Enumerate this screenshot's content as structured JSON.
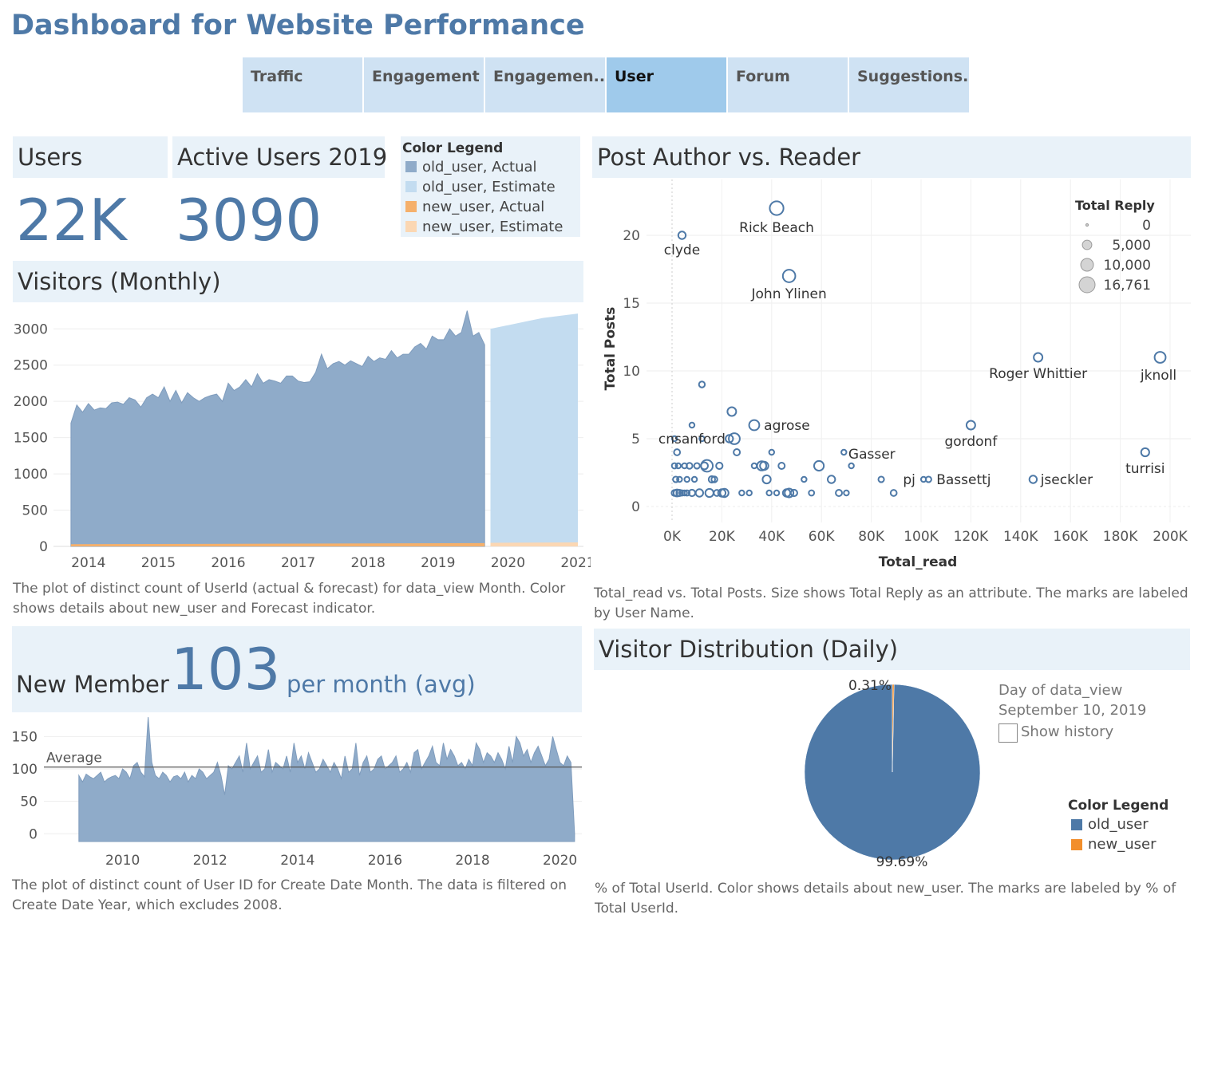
{
  "page": {
    "title": "Dashboard for Website Performance"
  },
  "tabs": [
    {
      "label": "Traffic",
      "active": false
    },
    {
      "label": "Engagement",
      "active": false
    },
    {
      "label": "Engagemen..",
      "active": false
    },
    {
      "label": "User",
      "active": true
    },
    {
      "label": "Forum",
      "active": false
    },
    {
      "label": "Suggestions..",
      "active": false
    }
  ],
  "kpis": {
    "users": {
      "label": "Users",
      "value": "22K"
    },
    "active": {
      "label": "Active Users 2019",
      "value": "3090"
    }
  },
  "color_legend_top": {
    "title": "Color Legend",
    "items": [
      {
        "label": "old_user, Actual",
        "color": "#8fabc9"
      },
      {
        "label": "old_user, Estimate",
        "color": "#c3dcf0"
      },
      {
        "label": "new_user, Actual",
        "color": "#f5b06b"
      },
      {
        "label": "new_user, Estimate",
        "color": "#fbd7b3"
      }
    ]
  },
  "visitors": {
    "header": "Visitors (Monthly)",
    "caption": "The plot of distinct count of UserId (actual & forecast)  for data_view Month.  Color shows details about new_user and Forecast indicator."
  },
  "new_member": {
    "prefix": "New Member",
    "value": "103",
    "suffix": "per month (avg)",
    "caption": "The plot of distinct count of User ID for Create Date Month. The data is filtered on Create Date Year, which excludes 2008."
  },
  "scatter": {
    "header": "Post Author vs. Reader",
    "caption": "Total_read vs. Total Posts.  Size shows Total Reply as an attribute.  The marks are labeled by User Name."
  },
  "pie": {
    "header": "Visitor Distribution (Daily)",
    "filter_label": "Day of data_view",
    "filter_value": "September 10, 2019",
    "show_history": "Show history",
    "legend_title": "Color Legend",
    "legend": [
      {
        "label": "old_user",
        "color": "#4e79a7"
      },
      {
        "label": "new_user",
        "color": "#f28e2b"
      }
    ],
    "caption": "% of Total UserId.  Color shows details about new_user.  The marks are labeled by % of Total UserId."
  },
  "chart_data": [
    {
      "type": "area",
      "x_ticks": [
        "2014",
        "2015",
        "2016",
        "2017",
        "2018",
        "2019",
        "2020",
        "2021"
      ],
      "y_ticks": [
        0,
        500,
        1000,
        1500,
        2000,
        2500,
        3000
      ],
      "ylim": [
        0,
        3300
      ],
      "series": [
        {
          "name": "old_user, Actual",
          "x": [
            "2013-10",
            "2013-11",
            "2013-12",
            "2014-01",
            "2014-02",
            "2014-03",
            "2014-04",
            "2014-05",
            "2014-06",
            "2014-07",
            "2014-08",
            "2014-09",
            "2014-10",
            "2014-11",
            "2014-12",
            "2015-01",
            "2015-02",
            "2015-03",
            "2015-04",
            "2015-05",
            "2015-06",
            "2015-07",
            "2015-08",
            "2015-09",
            "2015-10",
            "2015-11",
            "2015-12",
            "2016-01",
            "2016-02",
            "2016-03",
            "2016-04",
            "2016-05",
            "2016-06",
            "2016-07",
            "2016-08",
            "2016-09",
            "2016-10",
            "2016-11",
            "2016-12",
            "2017-01",
            "2017-02",
            "2017-03",
            "2017-04",
            "2017-05",
            "2017-06",
            "2017-07",
            "2017-08",
            "2017-09",
            "2017-10",
            "2017-11",
            "2017-12",
            "2018-01",
            "2018-02",
            "2018-03",
            "2018-04",
            "2018-05",
            "2018-06",
            "2018-07",
            "2018-08",
            "2018-09",
            "2018-10",
            "2018-11",
            "2018-12",
            "2019-01",
            "2019-02",
            "2019-03",
            "2019-04",
            "2019-05",
            "2019-06",
            "2019-07",
            "2019-08",
            "2019-09"
          ],
          "values": [
            1700,
            1950,
            1850,
            1970,
            1880,
            1910,
            1900,
            1980,
            1990,
            1960,
            2050,
            2020,
            1920,
            2050,
            2100,
            2050,
            2200,
            2000,
            2150,
            1980,
            2120,
            2050,
            2000,
            2050,
            2080,
            2100,
            2000,
            2250,
            2150,
            2200,
            2300,
            2200,
            2380,
            2250,
            2300,
            2280,
            2250,
            2350,
            2350,
            2280,
            2260,
            2270,
            2400,
            2650,
            2450,
            2520,
            2550,
            2500,
            2560,
            2520,
            2480,
            2620,
            2550,
            2600,
            2580,
            2700,
            2600,
            2650,
            2650,
            2750,
            2800,
            2720,
            2900,
            2850,
            2850,
            3000,
            2900,
            2950,
            3250,
            2900,
            2950,
            2780
          ]
        },
        {
          "name": "old_user, Estimate",
          "x": [
            "2019-10",
            "2020-01",
            "2020-04",
            "2020-07",
            "2020-10",
            "2021-01"
          ],
          "values": [
            3000,
            3050,
            3100,
            3150,
            3180,
            3210
          ]
        },
        {
          "name": "new_user, Actual",
          "x": [
            "2013-10",
            "2019-09"
          ],
          "values": [
            30,
            45
          ]
        },
        {
          "name": "new_user, Estimate",
          "x": [
            "2019-10",
            "2021-01"
          ],
          "values": [
            50,
            55
          ]
        }
      ]
    },
    {
      "type": "area",
      "x_ticks": [
        "2010",
        "2012",
        "2014",
        "2016",
        "2018",
        "2020"
      ],
      "y_ticks": [
        0,
        50,
        100,
        150
      ],
      "ylim": [
        -12,
        185
      ],
      "reference_line": {
        "label": "Average",
        "value": 103
      },
      "series": [
        {
          "name": "",
          "x_start": "2009-01",
          "values": [
            90,
            80,
            92,
            88,
            85,
            90,
            95,
            80,
            85,
            88,
            90,
            85,
            100,
            95,
            85,
            105,
            110,
            95,
            88,
            180,
            110,
            90,
            85,
            95,
            90,
            80,
            88,
            90,
            85,
            95,
            80,
            90,
            85,
            100,
            95,
            85,
            90,
            95,
            110,
            90,
            60,
            105,
            100,
            110,
            120,
            95,
            140,
            100,
            110,
            120,
            95,
            100,
            130,
            95,
            110,
            105,
            100,
            120,
            95,
            140,
            110,
            120,
            100,
            125,
            110,
            95,
            100,
            115,
            105,
            95,
            110,
            100,
            85,
            120,
            95,
            100,
            140,
            90,
            110,
            120,
            95,
            100,
            115,
            120,
            100,
            105,
            110,
            120,
            95,
            100,
            110,
            95,
            125,
            130,
            100,
            110,
            120,
            135,
            110,
            105,
            140,
            115,
            130,
            120,
            105,
            110,
            100,
            115,
            105,
            140,
            130,
            110,
            125,
            120,
            110,
            125,
            115,
            100,
            135,
            110,
            150,
            140,
            120,
            130,
            110,
            125,
            135,
            120,
            105,
            115,
            150,
            130,
            110,
            105,
            120,
            110,
            0
          ]
        }
      ]
    },
    {
      "type": "scatter",
      "xlabel": "Total_read",
      "ylabel": "Total Posts",
      "x_ticks": [
        "0K",
        "20K",
        "40K",
        "60K",
        "80K",
        "100K",
        "120K",
        "140K",
        "160K",
        "180K",
        "200K"
      ],
      "y_ticks": [
        0,
        5,
        10,
        15,
        20
      ],
      "xlim": [
        0,
        200000
      ],
      "ylim": [
        0,
        22
      ],
      "size_legend": {
        "title": "Total Reply",
        "values": [
          0,
          5000,
          10000,
          16761
        ],
        "labels": [
          "0",
          "5,000",
          "10,000",
          "16,761"
        ]
      },
      "labeled_points": [
        {
          "name": "clyde",
          "x": 4000,
          "y": 20,
          "size": 1500
        },
        {
          "name": "Rick Beach",
          "x": 42000,
          "y": 22,
          "size": 9000
        },
        {
          "name": "John Ylinen",
          "x": 47000,
          "y": 17,
          "size": 7000
        },
        {
          "name": "Roger Whittier",
          "x": 147000,
          "y": 11,
          "size": 2500
        },
        {
          "name": "jknoll",
          "x": 196000,
          "y": 11,
          "size": 5000
        },
        {
          "name": "cnsanford",
          "x": 24000,
          "y": 7,
          "size": 2500
        },
        {
          "name": "agrose",
          "x": 33000,
          "y": 6,
          "size": 4000
        },
        {
          "name": "gordonf",
          "x": 120000,
          "y": 6,
          "size": 2500
        },
        {
          "name": "Gasser",
          "x": 69000,
          "y": 4,
          "size": 300
        },
        {
          "name": "turrisi",
          "x": 190000,
          "y": 4,
          "size": 2000
        },
        {
          "name": "pj",
          "x": 101000,
          "y": 2,
          "size": 300
        },
        {
          "name": "Bassettj",
          "x": 103000,
          "y": 2,
          "size": 500
        },
        {
          "name": "jseckler",
          "x": 145000,
          "y": 2,
          "size": 1500
        }
      ],
      "other_points": [
        [
          1000,
          1,
          600
        ],
        [
          2000,
          1,
          1200
        ],
        [
          3000,
          1,
          800
        ],
        [
          4000,
          1,
          400
        ],
        [
          1500,
          2,
          500
        ],
        [
          2500,
          3,
          300
        ],
        [
          1000,
          5,
          300
        ],
        [
          2000,
          4,
          700
        ],
        [
          5000,
          3,
          300
        ],
        [
          6000,
          2,
          300
        ],
        [
          8000,
          1,
          900
        ],
        [
          9000,
          2,
          300
        ],
        [
          10000,
          3,
          500
        ],
        [
          11000,
          1,
          1500
        ],
        [
          12000,
          5,
          300
        ],
        [
          13000,
          3,
          1200
        ],
        [
          14000,
          3,
          6000
        ],
        [
          15000,
          1,
          2000
        ],
        [
          16000,
          2,
          900
        ],
        [
          17000,
          2,
          600
        ],
        [
          18000,
          1,
          700
        ],
        [
          19000,
          3,
          900
        ],
        [
          20000,
          1,
          1500
        ],
        [
          21000,
          1,
          2200
        ],
        [
          23000,
          5,
          1500
        ],
        [
          25000,
          5,
          5000
        ],
        [
          26000,
          4,
          800
        ],
        [
          28000,
          1,
          300
        ],
        [
          31000,
          1,
          300
        ],
        [
          33000,
          3,
          300
        ],
        [
          36000,
          3,
          3000
        ],
        [
          37000,
          3,
          2200
        ],
        [
          38000,
          2,
          2000
        ],
        [
          39000,
          1,
          300
        ],
        [
          40000,
          4,
          300
        ],
        [
          42000,
          1,
          300
        ],
        [
          44000,
          3,
          800
        ],
        [
          46000,
          1,
          1500
        ],
        [
          47000,
          1,
          2500
        ],
        [
          49000,
          1,
          900
        ],
        [
          53000,
          2,
          300
        ],
        [
          56000,
          1,
          400
        ],
        [
          59000,
          3,
          3500
        ],
        [
          64000,
          2,
          1500
        ],
        [
          67000,
          1,
          800
        ],
        [
          70000,
          1,
          300
        ],
        [
          72000,
          3,
          300
        ],
        [
          84000,
          2,
          500
        ],
        [
          89000,
          1,
          700
        ],
        [
          8000,
          6,
          300
        ],
        [
          12000,
          9,
          600
        ],
        [
          1000,
          3,
          400
        ],
        [
          3000,
          2,
          300
        ],
        [
          5000,
          1,
          300
        ],
        [
          6000,
          1,
          400
        ],
        [
          7000,
          3,
          600
        ]
      ]
    },
    {
      "type": "pie",
      "labels": [
        "old_user",
        "new_user"
      ],
      "values": [
        99.69,
        0.31
      ],
      "data_labels": [
        "99.69%",
        "0.31%"
      ]
    }
  ]
}
